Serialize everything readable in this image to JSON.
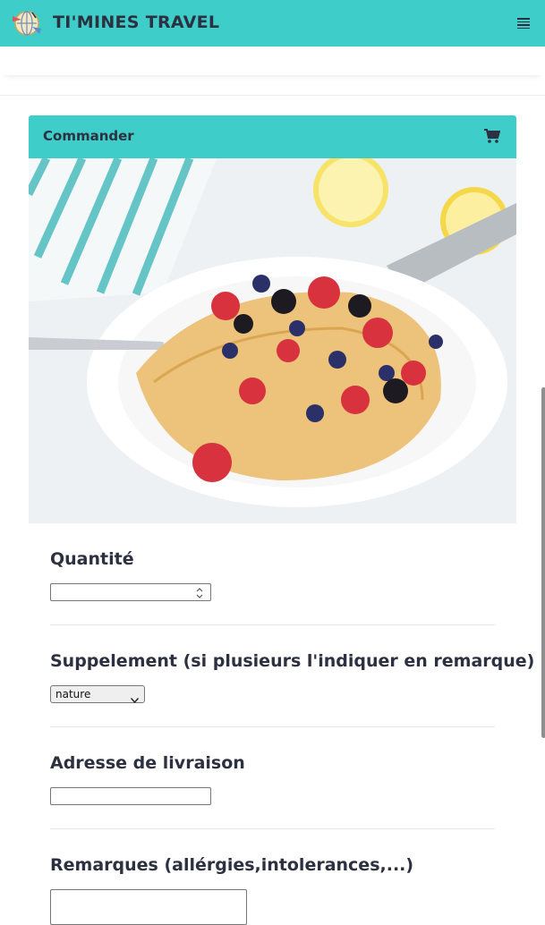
{
  "navbar": {
    "brand": "TI'MINES TRAVEL",
    "logo_icon": "world-travel-logo",
    "menu_icon": "hamburger-menu-icon",
    "accent_color": "#3ecdc8"
  },
  "order_card": {
    "title": "Commander",
    "cart_icon": "shopping-cart-icon",
    "image_subject": "crepe with strawberries, blueberries, blackberries and lemon"
  },
  "form": {
    "quantity": {
      "label": "Quantité",
      "value": ""
    },
    "supplement": {
      "label": "Suppelement (si plusieurs l'indiquer en remarque)",
      "selected": "nature"
    },
    "address": {
      "label": "Adresse de livraison",
      "value": ""
    },
    "remarks": {
      "label": "Remarques (allérgies,intolerances,...)",
      "value": ""
    }
  }
}
